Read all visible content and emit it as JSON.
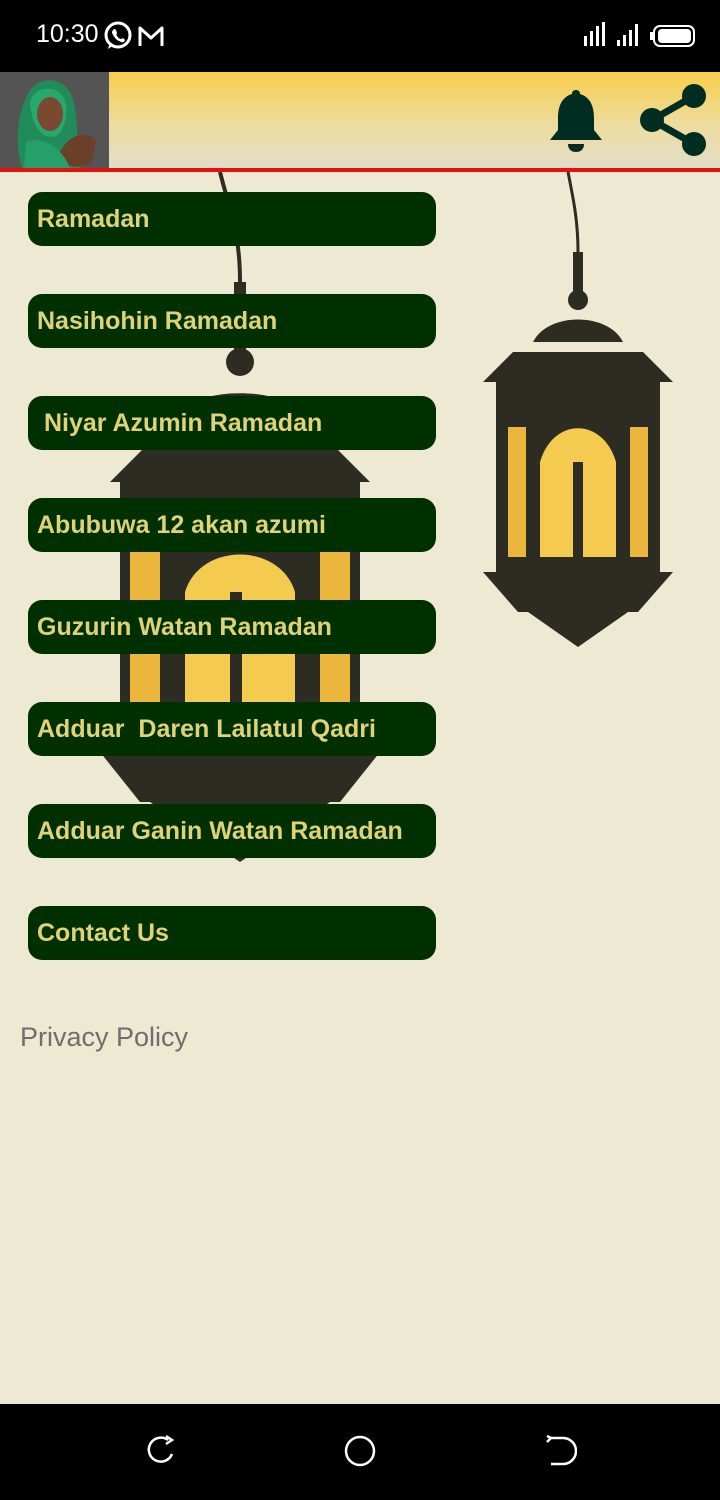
{
  "status_bar": {
    "time": "10:30",
    "icons": [
      "whatsapp-icon",
      "gmail-icon",
      "data-signal-icon",
      "cell-signal-icon",
      "battery-icon"
    ]
  },
  "app_bar": {
    "avatar": "woman-in-green-hijab-praying",
    "actions": [
      "bell-icon",
      "share-icon"
    ],
    "accent_line_color": "#e3120d"
  },
  "menu": {
    "items": [
      {
        "label": "Ramadan"
      },
      {
        "label": "Nasihohin Ramadan"
      },
      {
        "label": " Niyar Azumin Ramadan"
      },
      {
        "label": "Abubuwa 12 akan azumi"
      },
      {
        "label": "Guzurin Watan Ramadan"
      },
      {
        "label": "Adduar  Daren Lailatul Qadri"
      },
      {
        "label": "Adduar Ganin Watan Ramadan"
      },
      {
        "label": "Contact Us"
      }
    ]
  },
  "footer": {
    "privacy_label": "Privacy Policy"
  },
  "nav_bar": {
    "icons": [
      "recent-apps-icon",
      "home-icon",
      "back-icon"
    ]
  },
  "colors": {
    "background": "#ede9d2",
    "button_bg": "#003000",
    "button_text": "#dfd277"
  }
}
